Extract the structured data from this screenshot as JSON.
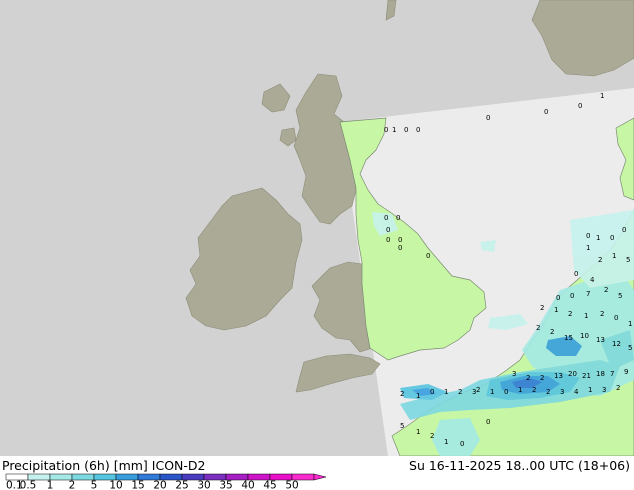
{
  "legend": {
    "title": "Precipitation (6h) [mm] ICON-D2",
    "datetime": "Su 16-11-2025 18..00 UTC (18+06)",
    "ticks": [
      "0.1",
      "0.5",
      "1",
      "2",
      "5",
      "10",
      "15",
      "20",
      "25",
      "30",
      "35",
      "40",
      "45",
      "50"
    ],
    "colors": [
      "#ffffff",
      "#c5f2ed",
      "#a4e9e5",
      "#7dd9e0",
      "#56c5e0",
      "#389ede",
      "#2f79d8",
      "#2a55c9",
      "#4a3bc0",
      "#7a2fc0",
      "#a61fc4",
      "#cd14c8",
      "#ea0fc9",
      "#fa2bcf"
    ]
  },
  "colors": {
    "sea": "#e6e6e6",
    "land_outside": "#aaaa96",
    "domain_sea": "#ececec",
    "domain_land": "#c7f7a5",
    "outside_sea": "#d2d2d2"
  },
  "map": {
    "precip_values": [
      "0",
      "1",
      "0",
      "0",
      "0",
      "0",
      "0",
      "1",
      "0",
      "0",
      "0",
      "0",
      "0",
      "0",
      "0",
      "0",
      "1",
      "0",
      "0",
      "1",
      "2",
      "1",
      "5",
      "0",
      "4",
      "2",
      "5",
      "0",
      "0",
      "7",
      "2",
      "1",
      "2",
      "1",
      "2",
      "0",
      "1",
      "2",
      "2",
      "15",
      "10",
      "13",
      "12",
      "5",
      "3",
      "2",
      "2",
      "13",
      "20",
      "21",
      "18",
      "7",
      "9",
      "2",
      "1",
      "0",
      "1",
      "2",
      "2",
      "3",
      "4",
      "1",
      "3",
      "2",
      "2",
      "1",
      "0",
      "1",
      "2",
      "3",
      "5",
      "1",
      "2",
      "1",
      "0",
      "0",
      "0",
      "0"
    ]
  }
}
